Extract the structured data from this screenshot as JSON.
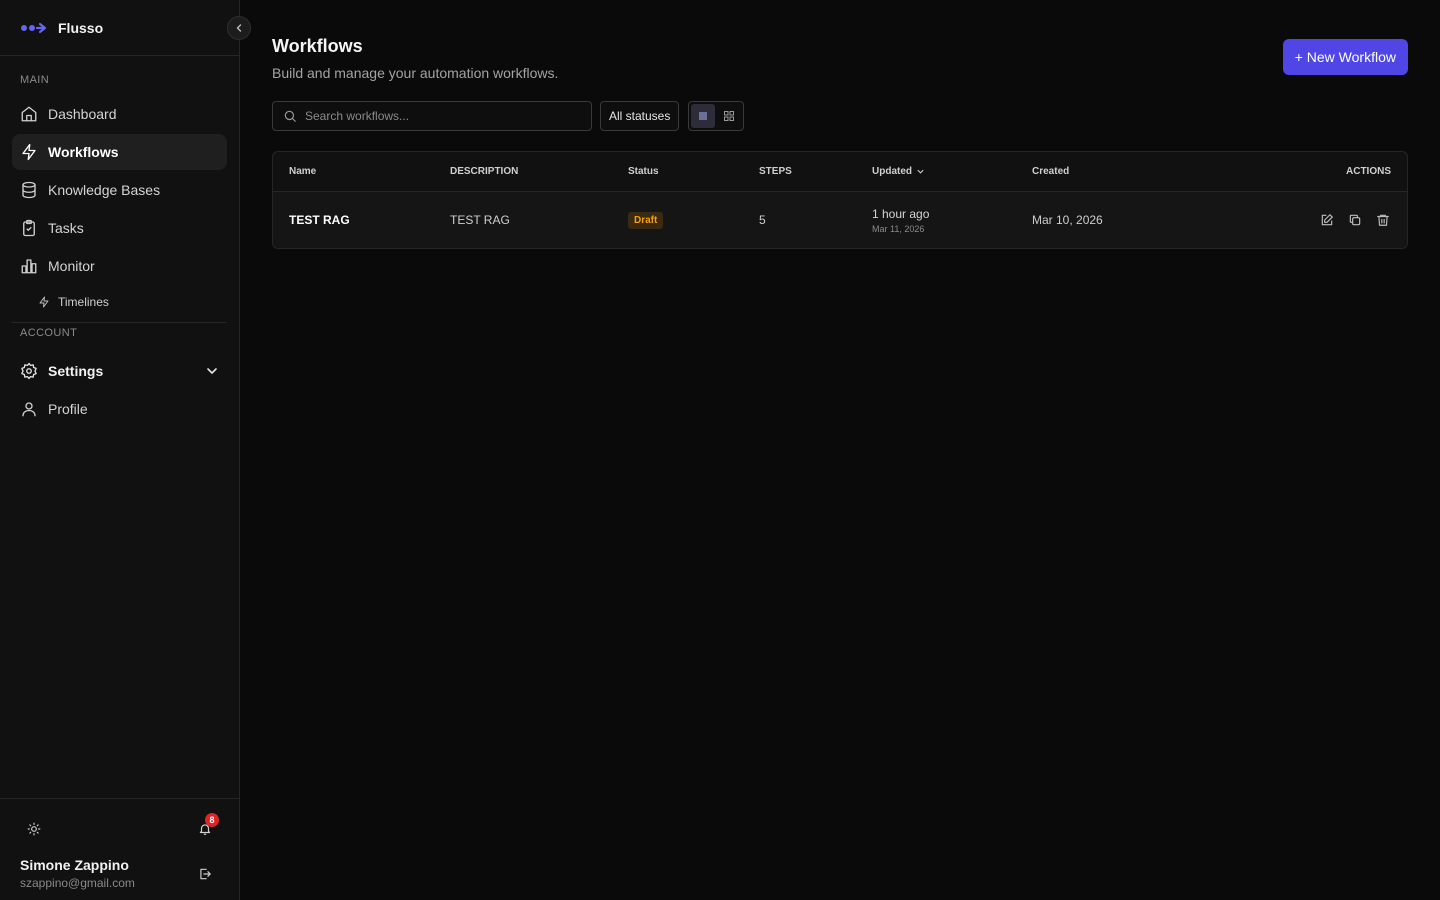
{
  "brand": {
    "name": "Flusso",
    "accent": "#6366f1"
  },
  "sidebar": {
    "main_label": "MAIN",
    "items": [
      {
        "label": "Dashboard",
        "icon": "home-icon"
      },
      {
        "label": "Workflows",
        "icon": "zap-icon",
        "active": true
      },
      {
        "label": "Knowledge Bases",
        "icon": "database-icon"
      },
      {
        "label": "Tasks",
        "icon": "clipboard-icon"
      },
      {
        "label": "Monitor",
        "icon": "bar-chart-icon"
      }
    ],
    "sub_items": [
      {
        "label": "Timelines",
        "icon": "zap-icon"
      }
    ],
    "account_label": "ACCOUNT",
    "account_items": [
      {
        "label": "Settings",
        "icon": "gear-icon",
        "expandable": true
      },
      {
        "label": "Profile",
        "icon": "user-icon"
      }
    ]
  },
  "footer": {
    "notifications_count": "8",
    "user_name": "Simone Zappino",
    "user_email": "szappino@gmail.com"
  },
  "page": {
    "title": "Workflows",
    "subtitle": "Build and manage your automation workflows.",
    "new_button": "+ New Workflow"
  },
  "toolbar": {
    "search_placeholder": "Search workflows...",
    "status_filter": "All statuses",
    "view_mode": "list"
  },
  "table": {
    "columns": [
      "Name",
      "DESCRIPTION",
      "Status",
      "STEPS",
      "Updated",
      "Created",
      "ACTIONS"
    ],
    "rows": [
      {
        "name": "TEST RAG",
        "description": "TEST RAG",
        "status": "Draft",
        "steps": "5",
        "updated_relative": "1 hour ago",
        "updated_date": "Mar 11, 2026",
        "created": "Mar 10, 2026"
      }
    ]
  },
  "colors": {
    "primary_button": "#4f46e5",
    "draft_badge": "#f59e0b",
    "notification": "#dc2626"
  }
}
